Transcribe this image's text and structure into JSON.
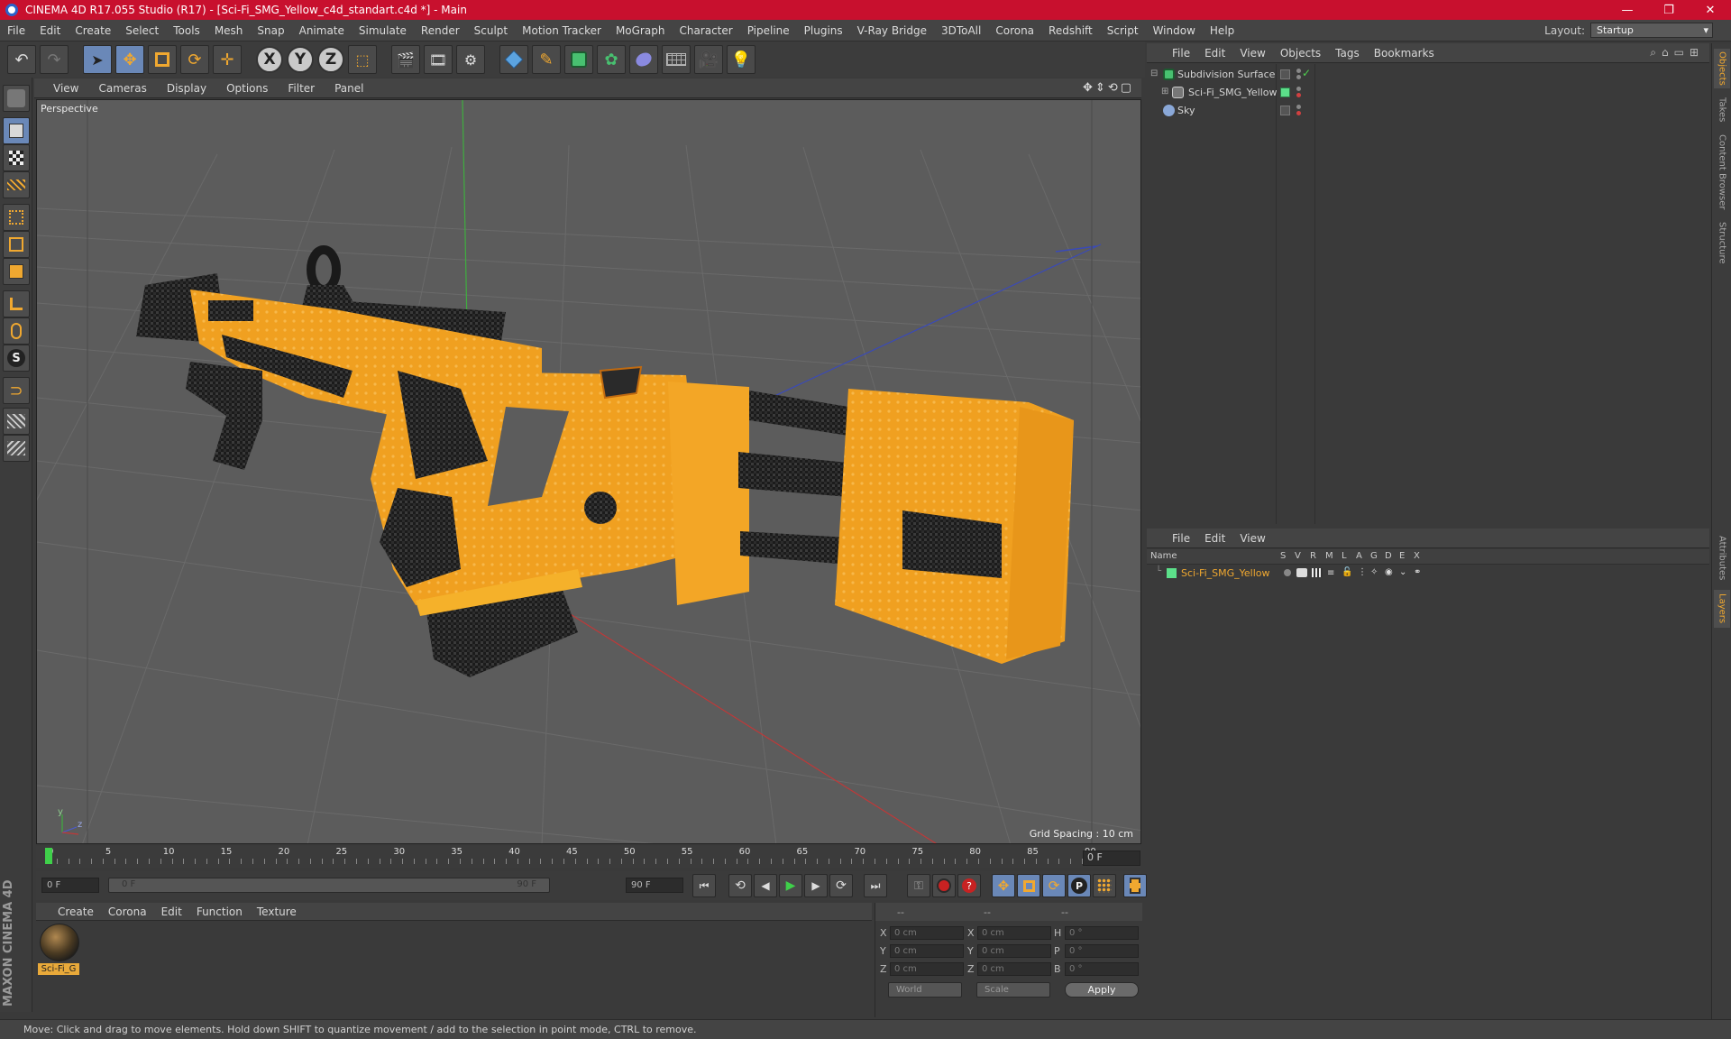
{
  "window": {
    "title": "CINEMA 4D R17.055 Studio (R17) - [Sci-Fi_SMG_Yellow_c4d_standart.c4d *] - Main",
    "minimize": "—",
    "maximize": "❐",
    "close": "✕"
  },
  "main_menu": [
    "File",
    "Edit",
    "Create",
    "Select",
    "Tools",
    "Mesh",
    "Snap",
    "Animate",
    "Simulate",
    "Render",
    "Sculpt",
    "Motion Tracker",
    "MoGraph",
    "Character",
    "Pipeline",
    "Plugins",
    "V-Ray Bridge",
    "3DToAll",
    "Corona",
    "Redshift",
    "Script",
    "Window",
    "Help"
  ],
  "layout": {
    "label": "Layout:",
    "value": "Startup"
  },
  "toolbar": {
    "axis_x": "X",
    "axis_y": "Y",
    "axis_z": "Z"
  },
  "viewport": {
    "menu": [
      "View",
      "Cameras",
      "Display",
      "Options",
      "Filter",
      "Panel"
    ],
    "label": "Perspective",
    "grid_spacing": "Grid Spacing : 10 cm",
    "axis_y": "y",
    "axis_z": "z"
  },
  "timeline": {
    "ticks": [
      "0",
      "5",
      "10",
      "15",
      "20",
      "25",
      "30",
      "35",
      "40",
      "45",
      "50",
      "55",
      "60",
      "65",
      "70",
      "75",
      "80",
      "85",
      "90"
    ],
    "current_frame": "0 F",
    "start_field": "0 F",
    "slider_start": "0 F",
    "slider_end": "90 F",
    "end_field": "90 F"
  },
  "materials": {
    "menu": [
      "Create",
      "Corona",
      "Edit",
      "Function",
      "Texture"
    ],
    "items": [
      {
        "name": "Sci-Fi_G"
      }
    ]
  },
  "coordinates": {
    "header": [
      "--",
      "--",
      "--"
    ],
    "rows": [
      {
        "a": "X",
        "av": "0 cm",
        "b": "X",
        "bv": "0 cm",
        "c": "H",
        "cv": "0 °"
      },
      {
        "a": "Y",
        "av": "0 cm",
        "b": "Y",
        "bv": "0 cm",
        "c": "P",
        "cv": "0 °"
      },
      {
        "a": "Z",
        "av": "0 cm",
        "b": "Z",
        "bv": "0 cm",
        "c": "B",
        "cv": "0 °"
      }
    ],
    "world": "World",
    "scale": "Scale",
    "apply": "Apply"
  },
  "status": "Move: Click and drag to move elements. Hold down SHIFT to quantize movement / add to the selection in point mode, CTRL to remove.",
  "objects_panel": {
    "menu": [
      "File",
      "Edit",
      "View",
      "Objects",
      "Tags",
      "Bookmarks"
    ],
    "items": [
      {
        "name": "Subdivision Surface"
      },
      {
        "name": "Sci-Fi_SMG_Yellow"
      },
      {
        "name": "Sky"
      }
    ]
  },
  "layers_panel": {
    "menu": [
      "File",
      "Edit",
      "View"
    ],
    "columns": [
      "Name",
      "S",
      "V",
      "R",
      "M",
      "L",
      "A",
      "G",
      "D",
      "E",
      "X"
    ],
    "items": [
      {
        "name": "Sci-Fi_SMG_Yellow",
        "color": "#5ce08a"
      }
    ]
  },
  "side_tabs": [
    "Objects",
    "Takes",
    "Content Browser",
    "Structure",
    "Attributes",
    "Layers"
  ],
  "branding": "MAXON CINEMA 4D",
  "colors": {
    "accent_orange": "#f0a830",
    "title_red": "#c8102e",
    "selected_blue": "#6a88b8"
  }
}
